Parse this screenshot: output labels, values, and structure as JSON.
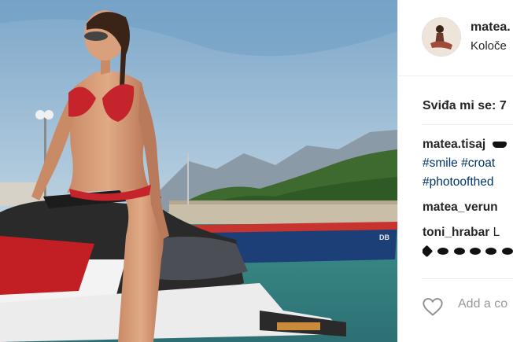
{
  "post": {
    "username": "matea.",
    "location": "Koloče",
    "likes_text": "Sviđa mi se: 7"
  },
  "comments": [
    {
      "user": "matea.tisaj",
      "text": ""
    },
    {
      "tags": [
        "#smile",
        "#croat"
      ]
    },
    {
      "tags": [
        "#photoofthed"
      ]
    },
    {
      "user": "matea_verun",
      "text": ""
    },
    {
      "user": "toni_hrabar",
      "text": "L"
    }
  ],
  "comment_box": {
    "placeholder": "Add a co"
  },
  "icons": {
    "like": "heart-icon"
  },
  "colors": {
    "hashtag": "#003569",
    "text": "#262626",
    "divider": "#efefef"
  }
}
